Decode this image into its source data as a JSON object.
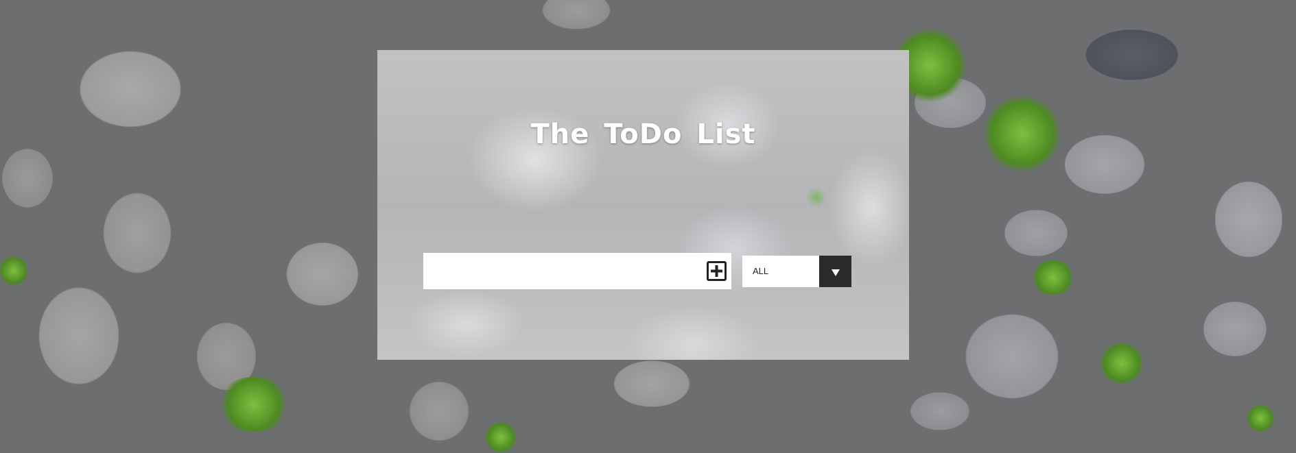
{
  "app": {
    "title": "The ToDo List"
  },
  "new_todo": {
    "value": "",
    "placeholder": "",
    "add_icon": "plus-square-icon"
  },
  "filter": {
    "selected": "ALL",
    "arrow_icon": "triangle-down-icon"
  },
  "colors": {
    "title_text": "#ffffff",
    "input_background": "#ffffff",
    "dropdown_arrow_background": "#2b2b2b"
  }
}
